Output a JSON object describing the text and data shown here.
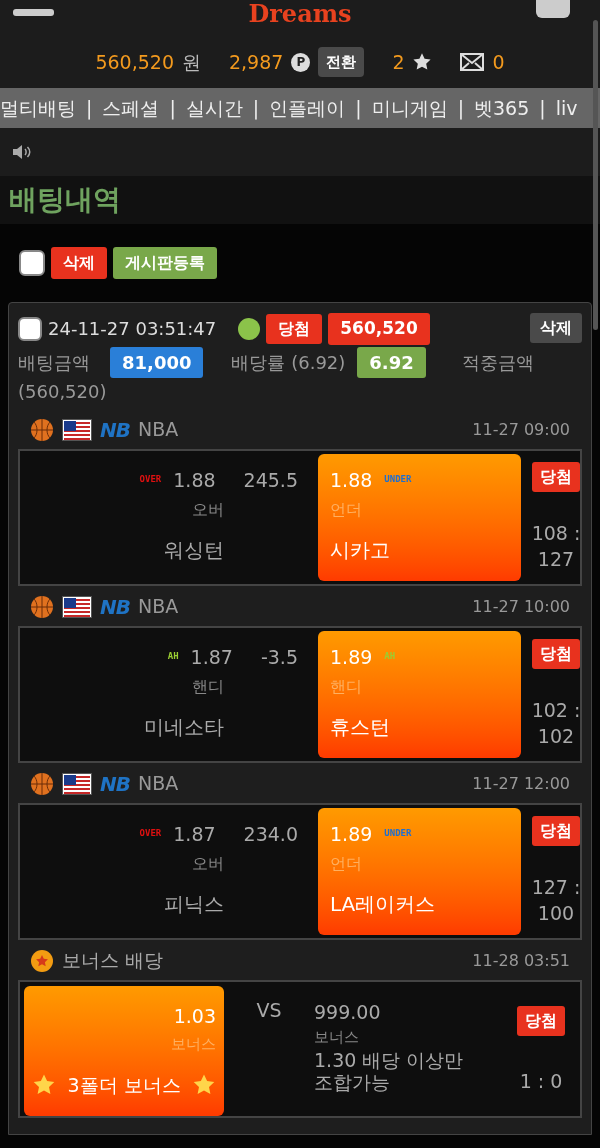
{
  "header": {
    "logo": "Dreams",
    "balance": "560,520",
    "currency": "원",
    "points": "2,987",
    "points_badge": "P",
    "convert_button": "전환",
    "stars_count": "2",
    "messages_count": "0"
  },
  "nav": [
    "멀티배팅",
    "|",
    "스페셜",
    "|",
    "실시간",
    "|",
    "인플레이",
    "|",
    "미니게임",
    "|",
    "벳365",
    "|",
    "liv"
  ],
  "page_title": "배팅내역",
  "toolbar": {
    "select_all_checked": false,
    "delete_button": "삭제",
    "post_button": "게시판등록"
  },
  "bet": {
    "checked": false,
    "datetime": "24-11-27 03:51:47",
    "status": {
      "color": "#8bc34a"
    },
    "result": "당첨",
    "payout": "560,520",
    "delete_button": "삭제",
    "bet_label": "배팅금액",
    "bet_amount": "81,000",
    "odds_label": "배당률 (6.92)",
    "odds": "6.92",
    "win_label": "적중금액",
    "win_amount": "(560,520)"
  },
  "games": [
    {
      "kind": "match",
      "league_logo": "NB",
      "league": "NBA",
      "time": "11-27 09:00",
      "home": {
        "odds": "1.88",
        "tag": {
          "text": "OVER",
          "color": "#e01010"
        },
        "label": "오버",
        "team": "워싱턴",
        "selected": false
      },
      "line": "245.5",
      "away": {
        "odds": "1.88",
        "tag": {
          "text": "UNDER",
          "color": "#1e6fd0"
        },
        "label": "언더",
        "team": "시카고",
        "selected": true
      },
      "result": "당첨",
      "score": "108 : 127"
    },
    {
      "kind": "match",
      "league_logo": "NB",
      "league": "NBA",
      "time": "11-27 10:00",
      "home": {
        "odds": "1.87",
        "tag": {
          "text": "AH",
          "color": "#9acd32"
        },
        "label": "핸디",
        "team": "미네소타",
        "selected": false
      },
      "line": "-3.5",
      "away": {
        "odds": "1.89",
        "tag": {
          "text": "AH",
          "color": "#9acd32"
        },
        "label": "핸디",
        "team": "휴스턴",
        "selected": true
      },
      "result": "당첨",
      "score": "102 : 102"
    },
    {
      "kind": "match",
      "league_logo": "NB",
      "league": "NBA",
      "time": "11-27 12:00",
      "home": {
        "odds": "1.87",
        "tag": {
          "text": "OVER",
          "color": "#e01010"
        },
        "label": "오버",
        "team": "피닉스",
        "selected": false
      },
      "line": "234.0",
      "away": {
        "odds": "1.89",
        "tag": {
          "text": "UNDER",
          "color": "#1e6fd0"
        },
        "label": "언더",
        "team": "LA레이커스",
        "selected": true
      },
      "result": "당첨",
      "score": "127 : 100"
    },
    {
      "kind": "bonus",
      "title": "보너스 배당",
      "time": "11-28 03:51",
      "home": {
        "odds": "1.03",
        "label": "보너스",
        "team": "3폴더 보너스",
        "selected": true
      },
      "vs": "VS",
      "away": {
        "odds": "999.00",
        "label": "보너스",
        "note": "1.30 배당 이상만 조합가능",
        "selected": false
      },
      "result": "당첨",
      "score": "1 : 0"
    }
  ]
}
